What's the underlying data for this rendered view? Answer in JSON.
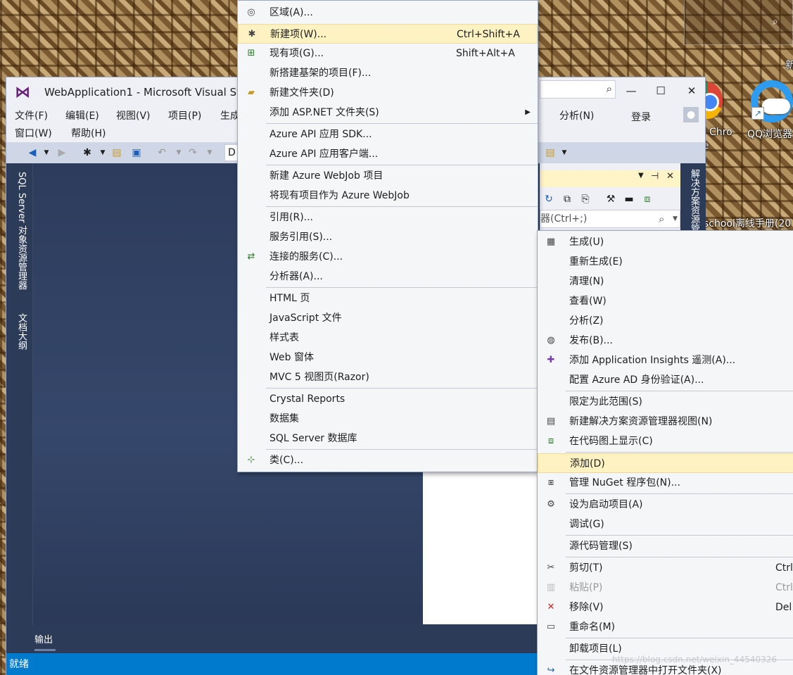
{
  "desktop": {
    "right_char": "新",
    "chrome_label": "Chro",
    "chrome_sub": "e",
    "qq_label": "QQ浏览器",
    "school_label": "school离线手册(20",
    "watermark": "https://blog.csdn.net/weixin_44540326"
  },
  "window": {
    "title": "WebApplication1 - Microsoft Visual St",
    "menu_row1": [
      "文件(F)",
      "编辑(E)",
      "视图(V)",
      "项目(P)",
      "生成"
    ],
    "menu_row2": [
      "窗口(W)",
      "帮助(H)"
    ],
    "menu_right": [
      "分析(N)",
      "登录"
    ],
    "toolbar_combo": "D",
    "side_tabs": [
      "SQL Server 对象资源管理器",
      "文档大纲"
    ],
    "output_tab": "输出",
    "status": "就绪",
    "solution_tab": "解决方案资源管理器",
    "filter_placeholder": "器(Ctrl+;)",
    "caption": {
      "minimize": "—",
      "maximize": "☐",
      "close": "✕"
    }
  },
  "add_submenu": {
    "items": [
      {
        "label": "区域(A)...",
        "shortcut": "",
        "icon": "area-icon"
      },
      {
        "label": "新建项(W)...",
        "shortcut": "Ctrl+Shift+A",
        "icon": "new-item-icon",
        "highlighted": true
      },
      {
        "label": "现有项(G)...",
        "shortcut": "Shift+Alt+A",
        "icon": "existing-item-icon"
      },
      {
        "label": "新搭建基架的项目(F)...",
        "shortcut": ""
      },
      {
        "label": "新建文件夹(D)",
        "shortcut": "",
        "icon": "new-folder-icon"
      },
      {
        "label": "添加 ASP.NET 文件夹(S)",
        "shortcut": "",
        "submenu": true
      },
      {
        "label": "Azure API 应用 SDK...",
        "shortcut": ""
      },
      {
        "label": "Azure API 应用客户端...",
        "shortcut": ""
      },
      {
        "label": "新建 Azure WebJob 项目",
        "shortcut": ""
      },
      {
        "label": "将现有项目作为 Azure WebJob",
        "shortcut": ""
      },
      {
        "label": "引用(R)...",
        "shortcut": ""
      },
      {
        "label": "服务引用(S)...",
        "shortcut": ""
      },
      {
        "label": "连接的服务(C)...",
        "shortcut": "",
        "icon": "connected-service-icon"
      },
      {
        "label": "分析器(A)...",
        "shortcut": ""
      },
      {
        "label": "HTML 页",
        "shortcut": ""
      },
      {
        "label": "JavaScript 文件",
        "shortcut": ""
      },
      {
        "label": "样式表",
        "shortcut": ""
      },
      {
        "label": "Web 窗体",
        "shortcut": ""
      },
      {
        "label": "MVC 5 视图页(Razor)",
        "shortcut": ""
      },
      {
        "label": "Crystal Reports",
        "shortcut": ""
      },
      {
        "label": "数据集",
        "shortcut": ""
      },
      {
        "label": "SQL Server 数据库",
        "shortcut": ""
      },
      {
        "label": "类(C)...",
        "shortcut": "",
        "icon": "class-icon"
      }
    ]
  },
  "context_menu": {
    "items": [
      {
        "label": "生成(U)",
        "shortcut": ""
      },
      {
        "label": "重新生成(E)",
        "shortcut": ""
      },
      {
        "label": "清理(N)",
        "shortcut": ""
      },
      {
        "label": "查看(W)",
        "shortcut": ""
      },
      {
        "label": "分析(Z)",
        "shortcut": ""
      },
      {
        "label": "发布(B)...",
        "shortcut": ""
      },
      {
        "label": "添加 Application Insights 遥测(A)...",
        "shortcut": ""
      },
      {
        "label": "配置 Azure AD 身份验证(A)...",
        "shortcut": ""
      },
      {
        "label": "限定为此范围(S)",
        "shortcut": ""
      },
      {
        "label": "新建解决方案资源管理器视图(N)",
        "shortcut": ""
      },
      {
        "label": "在代码图上显示(C)",
        "shortcut": ""
      },
      {
        "label": "添加(D)",
        "shortcut": "",
        "highlighted": true
      },
      {
        "label": "管理 NuGet 程序包(N)...",
        "shortcut": ""
      },
      {
        "label": "设为启动项目(A)",
        "shortcut": ""
      },
      {
        "label": "调试(G)",
        "shortcut": ""
      },
      {
        "label": "源代码管理(S)",
        "shortcut": ""
      },
      {
        "label": "剪切(T)",
        "shortcut": "Ctrl"
      },
      {
        "label": "粘贴(P)",
        "shortcut": "Ctrl",
        "disabled": true
      },
      {
        "label": "移除(V)",
        "shortcut": "Del"
      },
      {
        "label": "重命名(M)",
        "shortcut": ""
      },
      {
        "label": "卸载项目(L)",
        "shortcut": ""
      },
      {
        "label": "在文件资源管理器中打开文件夹(X)",
        "shortcut": ""
      }
    ]
  }
}
